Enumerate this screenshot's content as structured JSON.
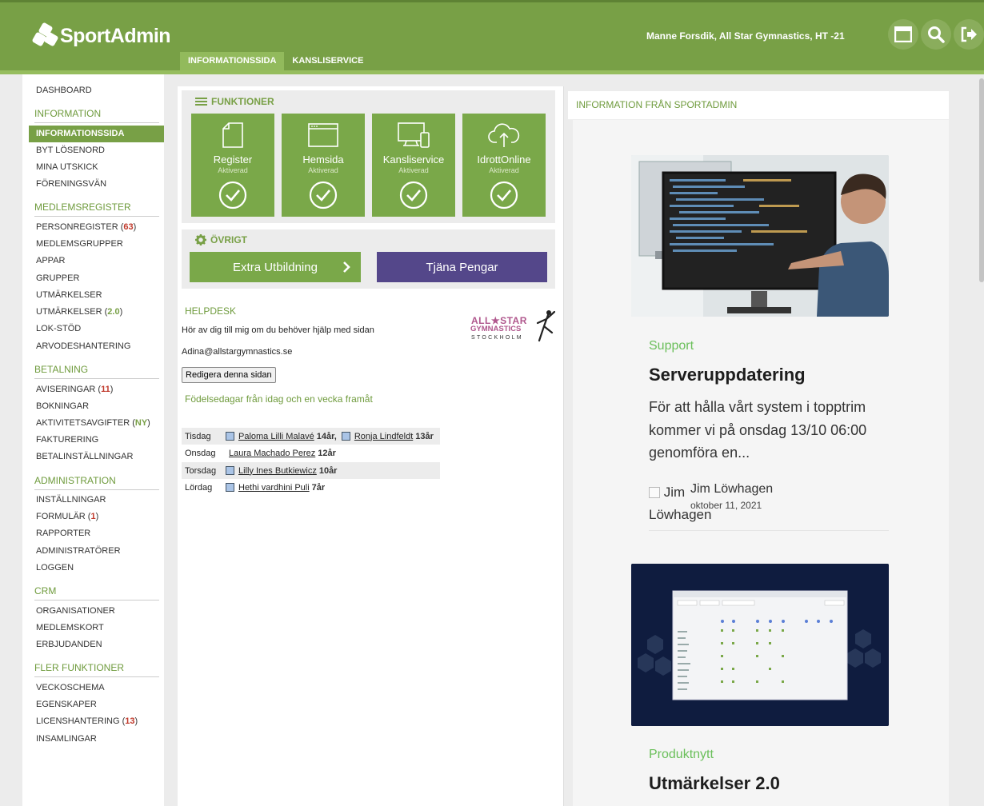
{
  "header": {
    "logo_text": "SportAdmin",
    "user": "Manne Forsdik, All Star Gymnastics, HT -21",
    "icons": [
      "window-icon",
      "search-icon",
      "logout-icon"
    ],
    "tabs": [
      {
        "label": "INFORMATIONSSIDA",
        "active": true
      },
      {
        "label": "KANSLISERVICE",
        "active": false
      }
    ],
    "colors": {
      "primary": "#78a046",
      "active_tab": "#92ba5c"
    }
  },
  "sidebar": {
    "dashboard": "DASHBOARD",
    "sections": {
      "information": {
        "title": "INFORMATION",
        "items": [
          "INFORMATIONSSIDA",
          "BYT LÖSENORD",
          "MINA UTSKICK",
          "FÖRENINGSVÄN"
        ]
      },
      "medlemsregister": {
        "title": "MEDLEMSREGISTER",
        "items": [
          "PERSONREGISTER",
          "MEDLEMSGRUPPER",
          "APPAR",
          "GRUPPER",
          "UTMÄRKELSER",
          "UTMÄRKELSER",
          "LOK-STÖD",
          "ARVODESHANTERING"
        ],
        "counts": {
          "personregister": "63",
          "utmarkelser2": "2.0"
        }
      },
      "betalning": {
        "title": "BETALNING",
        "items": [
          "AVISERINGAR",
          "BOKNINGAR",
          "AKTIVITETSAVGIFTER",
          "FAKTURERING",
          "BETALINSTÄLLNINGAR"
        ],
        "counts": {
          "aviseringar": "11",
          "aktivitetsavgifter": "NY"
        }
      },
      "administration": {
        "title": "ADMINISTRATION",
        "items": [
          "INSTÄLLNINGAR",
          "FORMULÄR",
          "RAPPORTER",
          "ADMINISTRATÖRER",
          "LOGGEN"
        ],
        "counts": {
          "formular": "1"
        }
      },
      "crm": {
        "title": "CRM",
        "items": [
          "ORGANISATIONER",
          "MEDLEMSKORT",
          "ERBJUDANDEN"
        ]
      },
      "fler": {
        "title": "FLER FUNKTIONER",
        "items": [
          "VECKOSCHEMA",
          "EGENSKAPER",
          "LICENSHANTERING",
          "INSAMLINGAR"
        ],
        "counts": {
          "licenshantering": "13"
        }
      }
    },
    "active_item": "INFORMATIONSSIDA"
  },
  "funktioner": {
    "title": "FUNKTIONER",
    "tiles": [
      {
        "name": "Register",
        "status": "Aktiverad",
        "icon": "document-icon"
      },
      {
        "name": "Hemsida",
        "status": "Aktiverad",
        "icon": "browser-window-icon"
      },
      {
        "name": "Kansliservice",
        "status": "Aktiverad",
        "icon": "devices-icon"
      },
      {
        "name": "IdrottOnline",
        "status": "Aktiverad",
        "icon": "cloud-upload-icon"
      }
    ]
  },
  "ovrigt": {
    "title": "ÖVRIGT",
    "btn1": "Extra Utbildning",
    "btn2": "Tjäna Pengar",
    "btn2_color": "#54478a"
  },
  "helpdesk": {
    "title": "HELPDESK",
    "text": "Hör av dig till mig om du behöver hjälp med sidan",
    "email": "Adina@allstargymnastics.se",
    "edit_button": "Redigera denna sidan",
    "logo_line1": "ALL★STAR",
    "logo_line2": "GYMNASTICS",
    "logo_line3": "STOCKHOLM"
  },
  "birthdays": {
    "title": "Födelsedagar från idag och en vecka framåt",
    "rows": [
      {
        "day": "Tisdag",
        "people": [
          {
            "name": "Paloma Lilli Malavé",
            "age": "14år,"
          },
          {
            "name": "Ronja Lindfeldt",
            "age": "13år"
          }
        ]
      },
      {
        "day": "Onsdag",
        "people": [
          {
            "name": "Laura Machado Perez",
            "age": "12år"
          }
        ]
      },
      {
        "day": "Torsdag",
        "people": [
          {
            "name": "Lilly Ines Butkiewicz",
            "age": "10år"
          }
        ]
      },
      {
        "day": "Lördag",
        "people": [
          {
            "name": "Hethi vardhini Puli",
            "age": "7år"
          }
        ]
      }
    ]
  },
  "news": {
    "header": "INFORMATION FRÅN SPORTADMIN",
    "articles": [
      {
        "category": "Support",
        "title": "Serveruppdatering",
        "excerpt": "För att hålla vårt system i topptrim kommer vi på onsdag 13/10 06:00 genomföra en...",
        "author_img_alt": "Jim Löwhagen",
        "author": "Jim Löwhagen",
        "date": "oktober 11, 2021"
      },
      {
        "category": "Produktnytt",
        "title": "Utmärkelser 2.0"
      }
    ]
  }
}
